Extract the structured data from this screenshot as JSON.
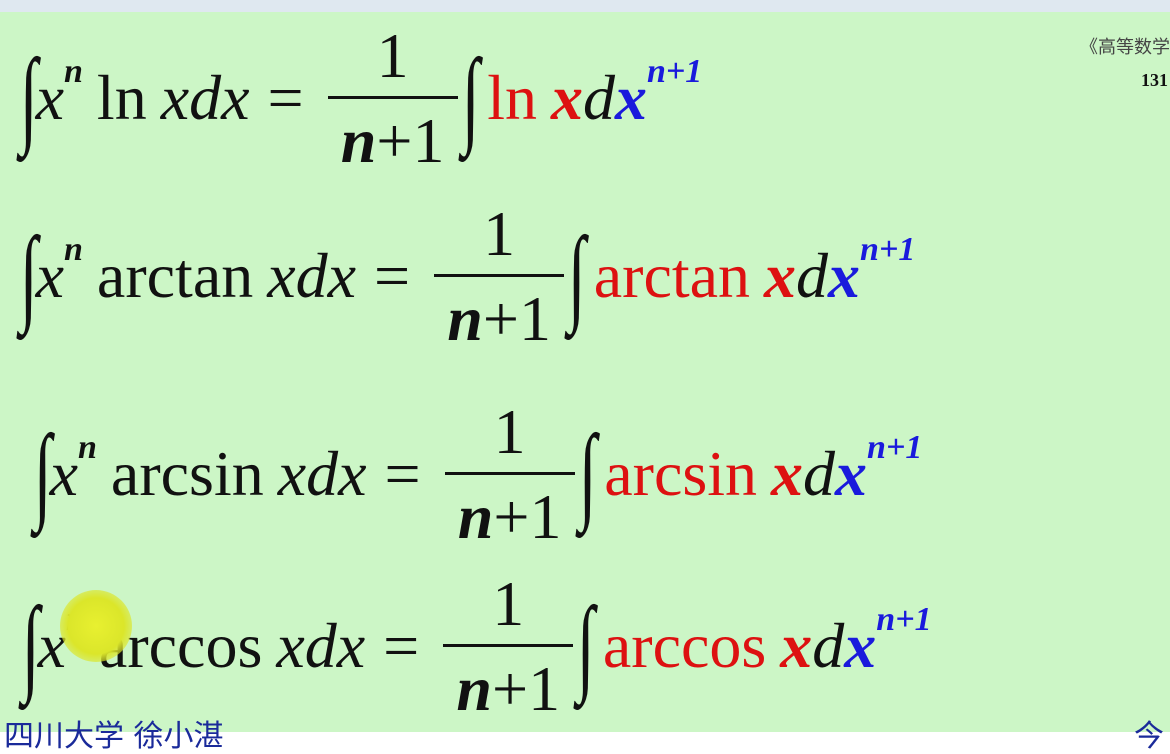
{
  "header": {
    "book_ref": "《高等数学",
    "page_number": "131"
  },
  "footer": {
    "left_text": "四川大学   徐小湛",
    "right_text": "今"
  },
  "fraction": {
    "numerator": "1",
    "denominator_n": "n",
    "denominator_rest": "+1"
  },
  "integral_symbol": "∫",
  "formulas": [
    {
      "lhs_var": "x",
      "lhs_power": "n",
      "func": "ln",
      "lhs_tail": "xdx",
      "equals": "=",
      "rhs_func": "ln",
      "rhs_x": "x",
      "rhs_d": "d",
      "rhs_dx": "x",
      "rhs_power": "n+1"
    },
    {
      "lhs_var": "x",
      "lhs_power": "n",
      "func": "arctan",
      "lhs_tail": "xdx",
      "equals": "=",
      "rhs_func": "arctan",
      "rhs_x": "x",
      "rhs_d": "d",
      "rhs_dx": "x",
      "rhs_power": "n+1"
    },
    {
      "lhs_var": "x",
      "lhs_power": "n",
      "func": "arcsin",
      "lhs_tail": "xdx",
      "equals": "=",
      "rhs_func": "arcsin",
      "rhs_x": "x",
      "rhs_d": "d",
      "rhs_dx": "x",
      "rhs_power": "n+1"
    },
    {
      "lhs_var": "x",
      "lhs_power": "n",
      "func": "arccos",
      "lhs_tail": "xdx",
      "equals": "=",
      "rhs_func": "arccos",
      "rhs_x": "x",
      "rhs_d": "d",
      "rhs_dx": "x",
      "rhs_power": "n+1"
    }
  ],
  "colors": {
    "background": "#ccf6c6",
    "highlight_red": "#dd1111",
    "highlight_blue": "#1a1adc",
    "pointer": "#e8f030"
  }
}
